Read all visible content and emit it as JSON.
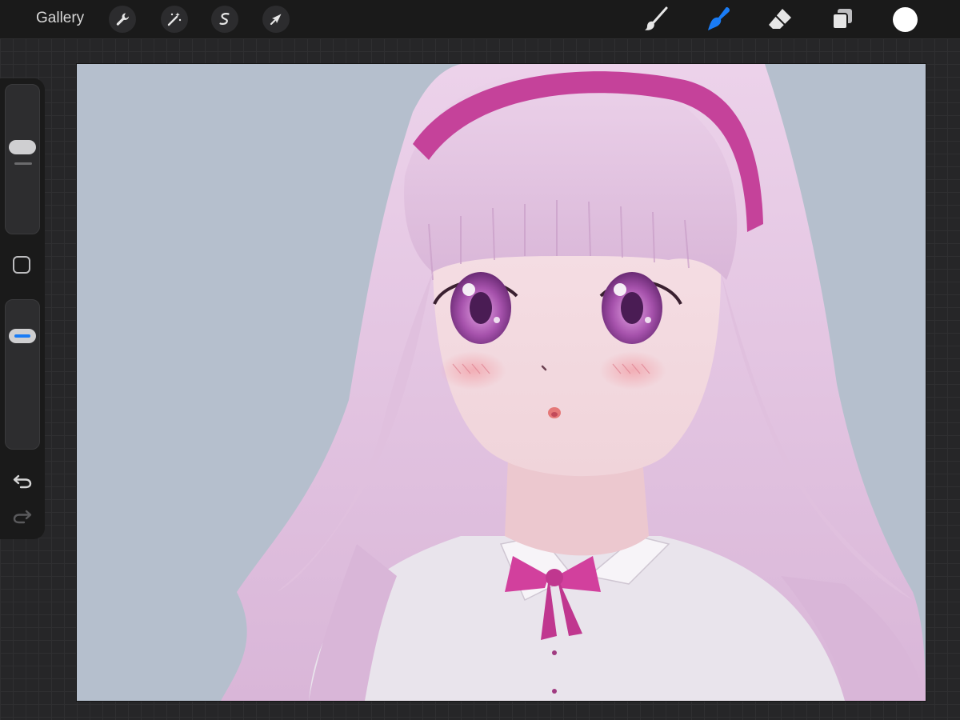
{
  "topbar": {
    "gallery_label": "Gallery",
    "left_tools": [
      {
        "icon": "wrench-icon",
        "name": "actions"
      },
      {
        "icon": "magic-wand-icon",
        "name": "adjustments"
      },
      {
        "icon": "selection-icon",
        "name": "selection"
      },
      {
        "icon": "arrow-cursor-icon",
        "name": "transform"
      }
    ],
    "right_tools": [
      {
        "icon": "brush-icon",
        "name": "paint"
      },
      {
        "icon": "smudge-icon",
        "name": "smudge",
        "active": true
      },
      {
        "icon": "eraser-icon",
        "name": "erase"
      },
      {
        "icon": "layers-icon",
        "name": "layers"
      }
    ],
    "current_color": "#ffffff"
  },
  "sidebar": {
    "size_slider_icon": "brush-size-slider",
    "modify_icon": "square-modify-icon",
    "opacity_slider_icon": "opacity-slider",
    "undo_icon": "undo-icon",
    "redo_icon": "redo-icon"
  },
  "colors": {
    "accent": "#1a7cf5",
    "canvas_background": "#b5bfcd",
    "hair": "#e2c4e0",
    "headband": "#c5429a",
    "eyes": "#a04aa6",
    "bow": "#d2409d",
    "shirt": "#e9e4ec"
  },
  "canvas": {
    "artwork": "anime-girl-illustration"
  }
}
